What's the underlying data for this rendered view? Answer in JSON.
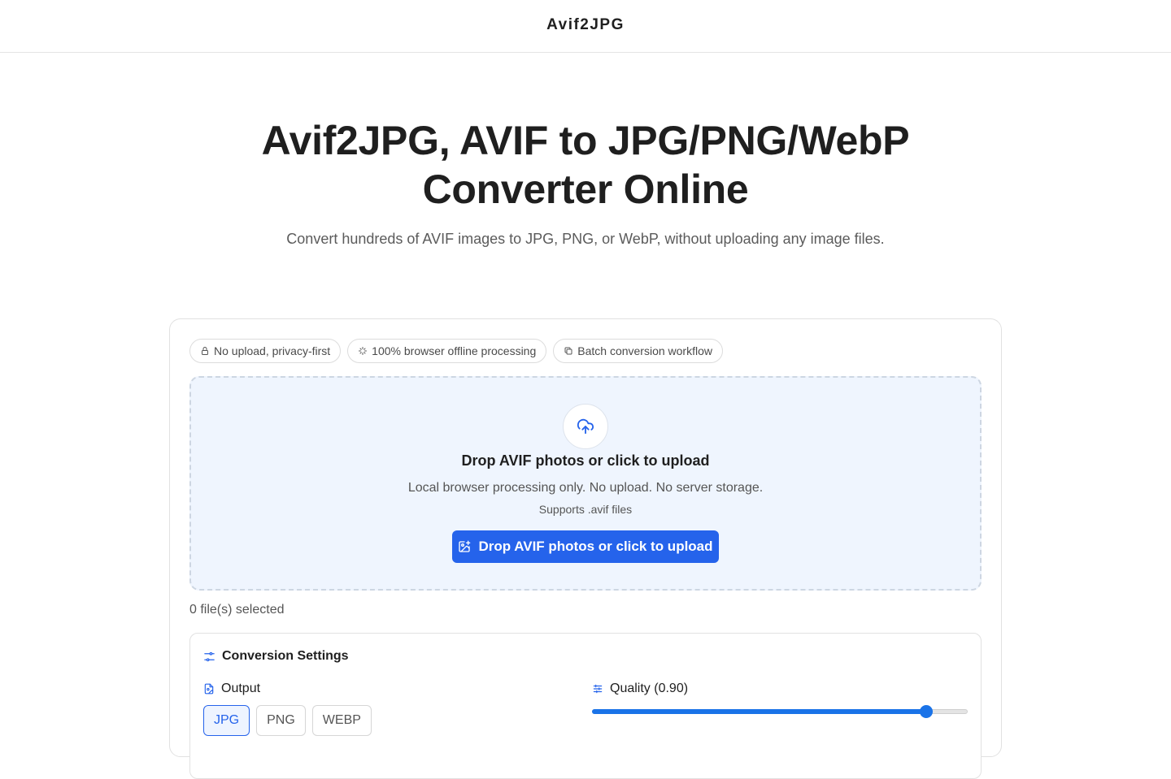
{
  "header": {
    "brand": "Avif2JPG"
  },
  "hero": {
    "title": "Avif2JPG, AVIF to JPG/PNG/WebP Converter Online",
    "subtitle": "Convert hundreds of AVIF images to JPG, PNG, or WebP, without uploading any image files."
  },
  "badges": [
    {
      "label": "No upload, privacy-first",
      "icon": "lock-icon"
    },
    {
      "label": "100% browser offline processing",
      "icon": "sparkles-icon"
    },
    {
      "label": "Batch conversion workflow",
      "icon": "copy-icon"
    }
  ],
  "dropzone": {
    "icon": "cloud-upload-icon",
    "title": "Drop AVIF photos or click to upload",
    "description": "Local browser processing only. No upload. No server storage.",
    "supports": "Supports .avif files",
    "button_label": "Drop AVIF photos or click to upload",
    "button_icon": "image-plus-icon"
  },
  "file_count": "0 file(s) selected",
  "settings": {
    "title": "Conversion Settings",
    "output_label": "Output",
    "formats": [
      "JPG",
      "PNG",
      "WEBP"
    ],
    "selected_format": "JPG",
    "quality_label": "Quality (0.90)",
    "quality_value": 0.9
  },
  "colors": {
    "accent": "#2563eb",
    "dropzone_bg": "#eff5fe"
  }
}
